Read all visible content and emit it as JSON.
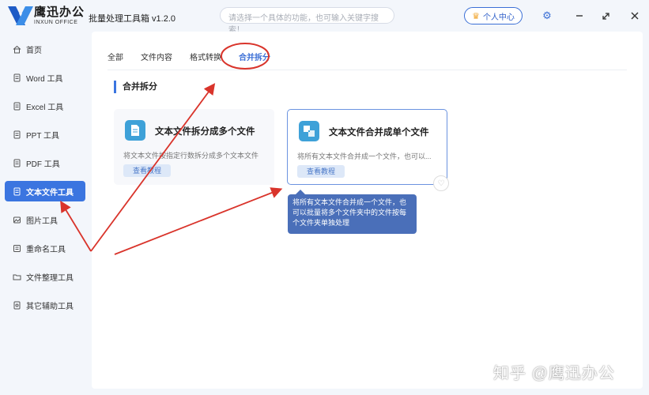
{
  "titlebar": {
    "brand_cn": "鹰迅办公",
    "brand_en": "INXUN OFFICE",
    "app_title": "批量处理工具箱 v1.2.0",
    "search_placeholder": "请选择一个具体的功能，也可输入关键字搜索！",
    "user_center": "个人中心"
  },
  "sidebar": {
    "items": [
      {
        "label": "首页",
        "icon": "home-icon"
      },
      {
        "label": "Word 工具",
        "icon": "word-icon"
      },
      {
        "label": "Excel 工具",
        "icon": "excel-icon"
      },
      {
        "label": "PPT 工具",
        "icon": "ppt-icon"
      },
      {
        "label": "PDF 工具",
        "icon": "pdf-icon"
      },
      {
        "label": "文本文件工具",
        "icon": "text-file-icon",
        "active": true
      },
      {
        "label": "图片工具",
        "icon": "image-icon"
      },
      {
        "label": "重命名工具",
        "icon": "rename-icon"
      },
      {
        "label": "文件整理工具",
        "icon": "folder-icon"
      },
      {
        "label": "其它辅助工具",
        "icon": "tools-icon"
      }
    ]
  },
  "main": {
    "tabs": [
      {
        "label": "全部"
      },
      {
        "label": "文件内容"
      },
      {
        "label": "格式转换"
      },
      {
        "label": "合并拆分",
        "active": true
      }
    ],
    "section_title": "合并拆分",
    "cards": [
      {
        "title": "文本文件拆分成多个文件",
        "desc": "将文本文件按指定行数拆分成多个文本文件",
        "button": "查看教程"
      },
      {
        "title": "文本文件合并成单个文件",
        "desc": "将所有文本文件合并成一个文件，也可以...",
        "button": "查看教程"
      }
    ],
    "tooltip": {
      "line1": "将所有文本文件合并成一个文件，也",
      "line2": "可以批量将多个文件夹中的文件按每",
      "line3": "个文件夹单独处理"
    }
  },
  "watermark": "知乎 @鹰迅办公",
  "colors": {
    "accent": "#3b75e0",
    "annotation": "#d9342b",
    "tooltip": "#4a6fb9"
  }
}
